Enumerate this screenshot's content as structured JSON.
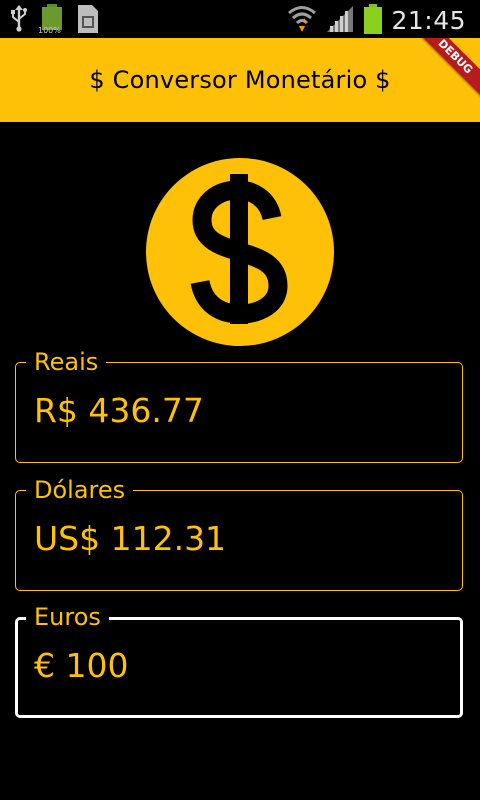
{
  "status_bar": {
    "time": "21:45",
    "battery_small_label": "100%"
  },
  "app_bar": {
    "title": "$ Conversor Monetário $",
    "debug_banner": "DEBUG"
  },
  "fields": [
    {
      "label": "Reais",
      "value": "R$ 436.77",
      "focused": false
    },
    {
      "label": "Dólares",
      "value": "US$ 112.31",
      "focused": false
    },
    {
      "label": "Euros",
      "value": "€ 100",
      "focused": true
    }
  ],
  "colors": {
    "accent": "#ffc107",
    "background": "#000000",
    "focused_border": "#ffffff",
    "debug_banner": "#b71c1c"
  },
  "icons": {
    "logo": "dollar-coin-icon"
  }
}
